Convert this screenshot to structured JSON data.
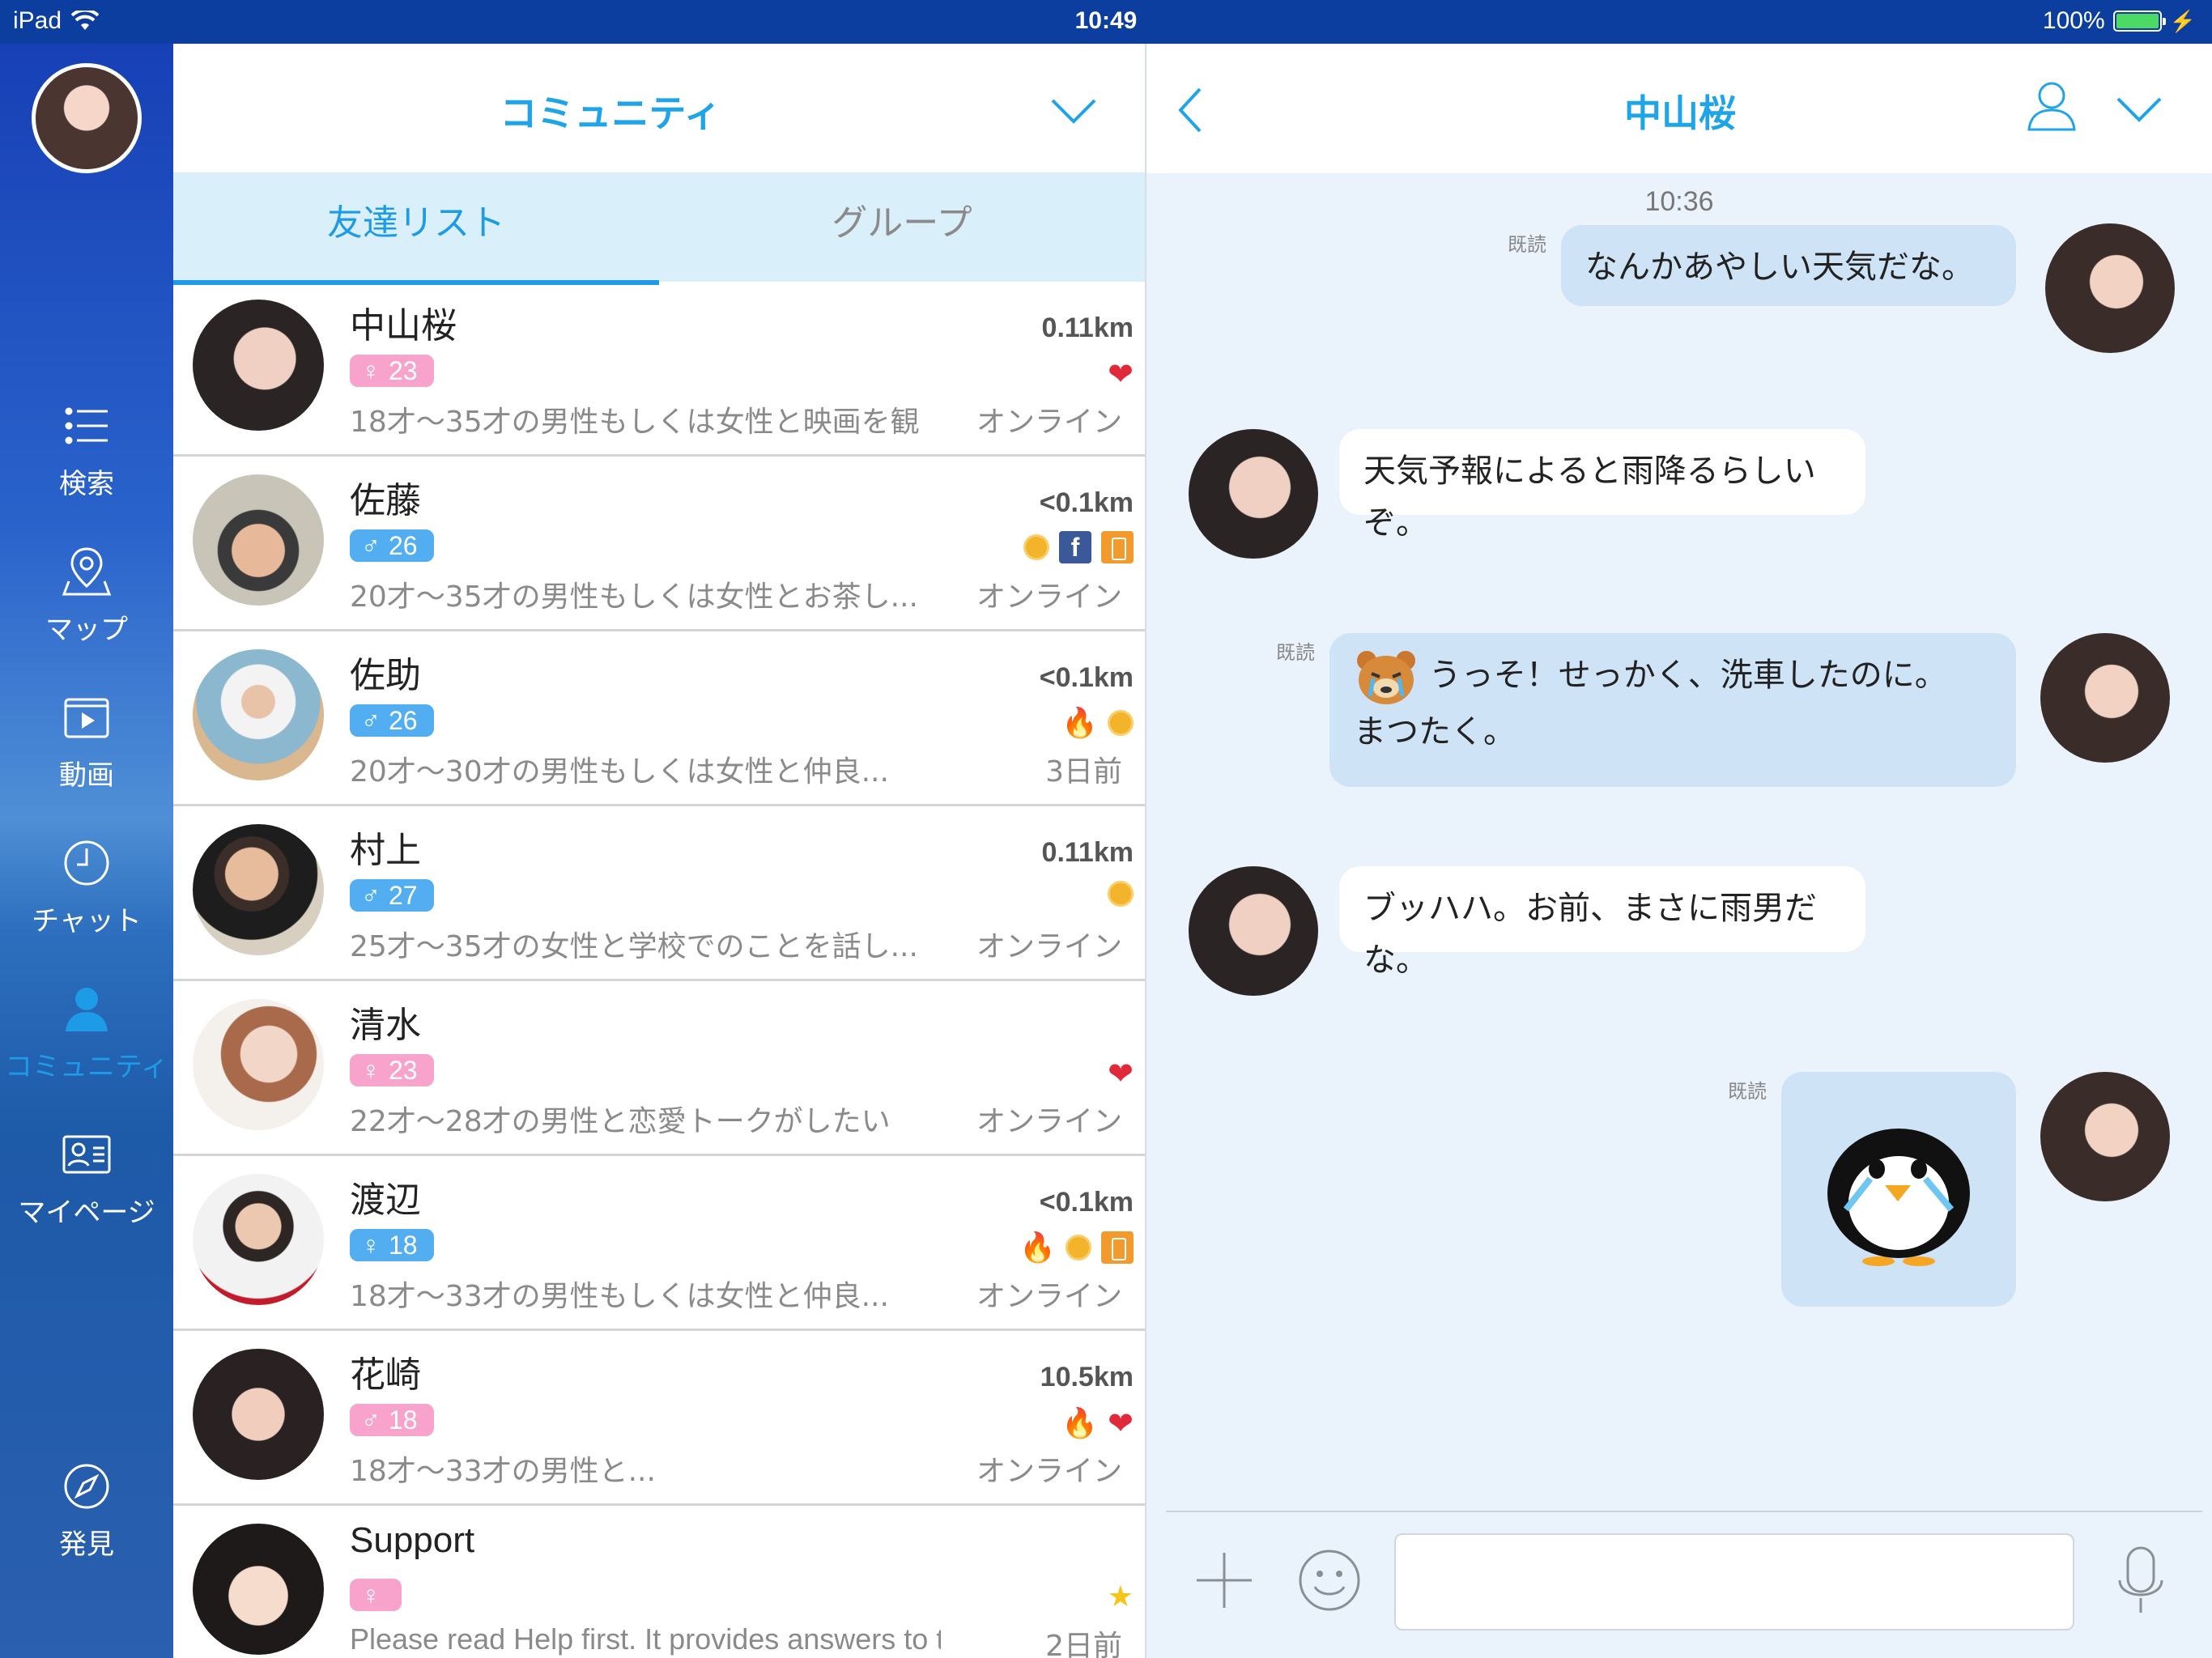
{
  "status_bar": {
    "device": "iPad",
    "time": "10:49",
    "battery": "100%"
  },
  "sidebar": {
    "items": [
      {
        "label": "検索",
        "icon": "list-search-icon"
      },
      {
        "label": "マップ",
        "icon": "map-icon"
      },
      {
        "label": "動画",
        "icon": "video-icon"
      },
      {
        "label": "チャット",
        "icon": "clock-icon"
      },
      {
        "label": "コミュニティ",
        "icon": "person-icon"
      },
      {
        "label": "マイページ",
        "icon": "profile-card-icon"
      },
      {
        "label": "発見",
        "icon": "compass-icon"
      }
    ],
    "active_color": "#1e9be6"
  },
  "community": {
    "title": "コミュニティ",
    "tabs": [
      {
        "label": "友達リスト",
        "active": true
      },
      {
        "label": "グループ",
        "active": false
      }
    ],
    "friends": [
      {
        "name": "中山桜",
        "gender": "female",
        "age": "23",
        "distance": "0.11km",
        "desc": "18才〜35才の男性もしくは女性と映画を観",
        "status": "オンライン",
        "icons": [
          "heart"
        ]
      },
      {
        "name": "佐藤",
        "gender": "male",
        "age": "26",
        "distance": "<0.1km",
        "desc": "20才〜35才の男性もしくは女性とお茶し...",
        "status": "オンライン",
        "icons": [
          "coin",
          "facebook",
          "phone"
        ]
      },
      {
        "name": "佐助",
        "gender": "male",
        "age": "26",
        "distance": "<0.1km",
        "desc": "20才〜30才の男性もしくは女性と仲良...",
        "status": "3日前",
        "icons": [
          "fire",
          "coin"
        ]
      },
      {
        "name": "村上",
        "gender": "male",
        "age": "27",
        "distance": "0.11km",
        "desc": "25才〜35才の女性と学校でのことを話し...",
        "status": "オンライン",
        "icons": [
          "coin"
        ]
      },
      {
        "name": "清水",
        "gender": "female",
        "age": "23",
        "distance": "",
        "desc": "22才〜28才の男性と恋愛トークがしたい",
        "status": "オンライン",
        "icons": [
          "heart"
        ]
      },
      {
        "name": "渡辺",
        "gender": "female",
        "age": "18",
        "distance": "<0.1km",
        "desc": "18才〜33才の男性もしくは女性と仲良...",
        "status": "オンライン",
        "icons": [
          "fire",
          "coin",
          "phone"
        ]
      },
      {
        "name": "花崎",
        "gender": "male",
        "age": "18",
        "distance": "10.5km",
        "desc": "18才〜33才の男性と...",
        "status": "オンライン",
        "icons": [
          "fire",
          "heart"
        ]
      },
      {
        "name": "Support",
        "gender": "female",
        "age": "",
        "distance": "",
        "desc": "Please read Help first. It provides answers to t...",
        "status": "2日前",
        "icons": [
          "star"
        ]
      }
    ]
  },
  "chat": {
    "title": "中山桜",
    "time": "10:36",
    "read_label": "既読",
    "messages": [
      {
        "from": "me",
        "text": "なんかあやしい天気だな。"
      },
      {
        "from": "them",
        "text": "天気予報によると雨降るらしいぞ。"
      },
      {
        "from": "me",
        "text_line1": "うっそ！せっかく、洗車したのに。",
        "text_line2": "まつたく。"
      },
      {
        "from": "them",
        "text": "ブッハハ。お前、まさに雨男だな。"
      },
      {
        "from": "me",
        "sticker": "penguin-sticker"
      }
    ]
  },
  "colors": {
    "accent": "#1fa4e8",
    "pink_badge": "#f7a3cc",
    "blue_badge": "#52aef0"
  }
}
